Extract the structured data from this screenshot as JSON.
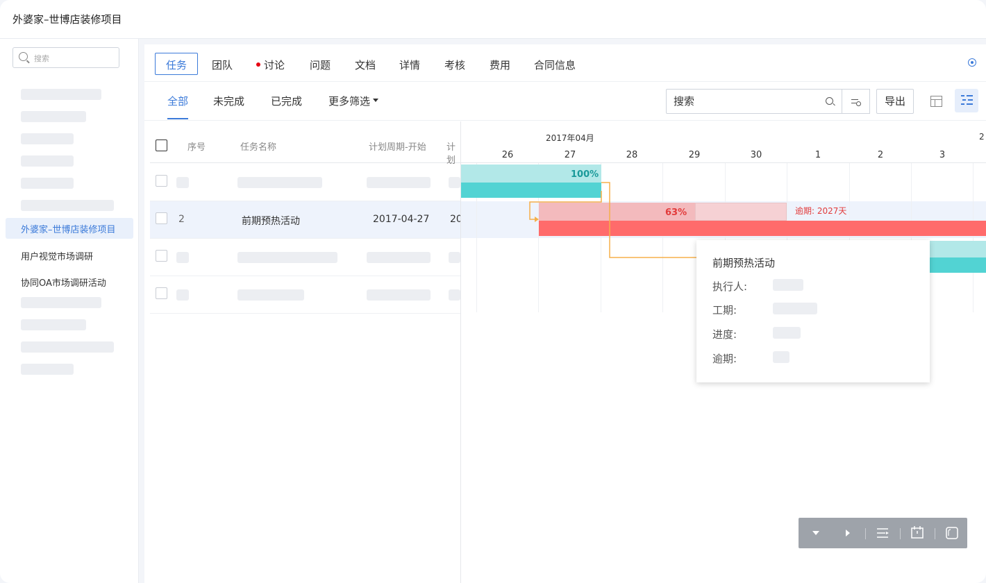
{
  "window": {
    "title": "外婆家–世博店装修项目"
  },
  "sidebar": {
    "search_placeholder": "搜索",
    "active_item": "外婆家–世博店装修项目",
    "items": [
      "用户视觉市场调研",
      "协同OA市场调研活动"
    ]
  },
  "tabs": [
    {
      "label": "任务",
      "active": true
    },
    {
      "label": "团队"
    },
    {
      "label": "讨论",
      "has_dot": true
    },
    {
      "label": "问题"
    },
    {
      "label": "文档"
    },
    {
      "label": "详情"
    },
    {
      "label": "考核"
    },
    {
      "label": "费用"
    },
    {
      "label": "合同信息"
    }
  ],
  "filters": {
    "all": "全部",
    "incomplete": "未完成",
    "complete": "已完成",
    "more": "更多筛选",
    "search_placeholder": "搜索",
    "export": "导出"
  },
  "table": {
    "columns": {
      "seq": "序号",
      "name": "任务名称",
      "start": "计划周期-开始",
      "end_trunc": "计划"
    },
    "row2": {
      "seq": "2",
      "name": "前期预热活动",
      "start": "2017-04-27",
      "end_trunc": "20"
    }
  },
  "gantt": {
    "month_label": "2017年04月",
    "next_month_trunc": "2",
    "days": [
      "26",
      "27",
      "28",
      "29",
      "30",
      "1",
      "2",
      "3"
    ],
    "task1": {
      "progress_label": "100%",
      "progress": 1.0,
      "color": "#52d3d3"
    },
    "task2": {
      "progress_label": "63%",
      "progress": 0.63,
      "color": "#ff6b6b",
      "overdue_label": "逾期: 2027天"
    },
    "link_color": "#f5b04a"
  },
  "tooltip": {
    "title": "前期预热活动",
    "fields": {
      "assignee": "执行人:",
      "duration": "工期:",
      "progress": "进度:",
      "overdue": "逾期:"
    }
  },
  "colors": {
    "accent": "#3b7ad9",
    "overdue": "#e23b3b",
    "complete": "#52d3d3"
  }
}
